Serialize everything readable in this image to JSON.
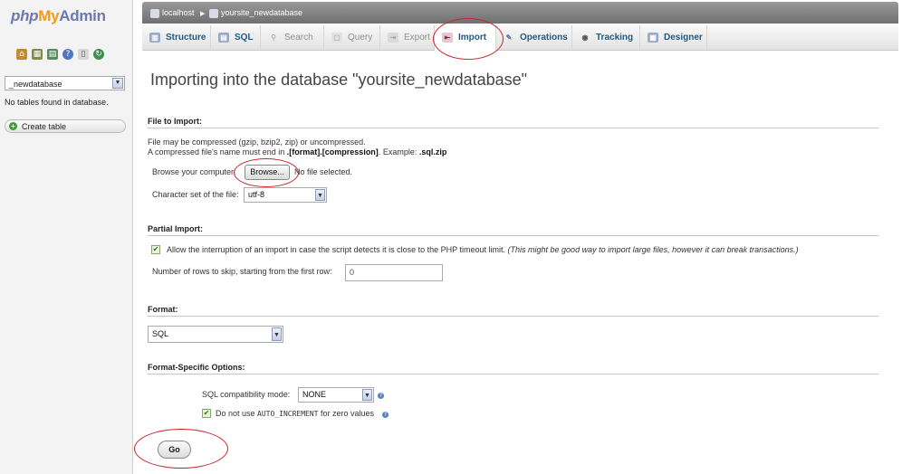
{
  "sidebar": {
    "logo": {
      "php": "php",
      "my": "My",
      "admin": "Admin"
    },
    "quick_icons": [
      "home-icon",
      "table-icon",
      "sql-icon",
      "help-icon",
      "docs-icon",
      "reload-icon"
    ],
    "database_select": "_newdatabase",
    "no_tables_text": "No tables found in database.",
    "create_table_label": "Create table"
  },
  "breadcrumb": {
    "server": "localhost",
    "database": "yoursite_newdatabase"
  },
  "tabs": [
    {
      "label": "Structure",
      "icon": "structure-icon",
      "state": "normal"
    },
    {
      "label": "SQL",
      "icon": "sql-icon",
      "state": "normal"
    },
    {
      "label": "Search",
      "icon": "search-icon",
      "state": "disabled"
    },
    {
      "label": "Query",
      "icon": "query-icon",
      "state": "disabled"
    },
    {
      "label": "Export",
      "icon": "export-icon",
      "state": "disabled"
    },
    {
      "label": "Import",
      "icon": "import-icon",
      "state": "active"
    },
    {
      "label": "Operations",
      "icon": "operations-icon",
      "state": "normal"
    },
    {
      "label": "Tracking",
      "icon": "tracking-icon",
      "state": "normal"
    },
    {
      "label": "Designer",
      "icon": "designer-icon",
      "state": "normal"
    }
  ],
  "page_title": "Importing into the database \"yoursite_newdatabase\"",
  "file_to_import": {
    "title": "File to Import:",
    "compress_note": "File may be compressed (gzip, bzip2, zip) or uncompressed.",
    "name_note_prefix": "A compressed file's name must end in ",
    "name_note_format": ".[format].[compression]",
    "name_note_example_label": ". Example: ",
    "name_note_example": ".sql.zip",
    "browse_label": "Browse your computer:",
    "browse_button": "Browse...",
    "no_file_text": "No file selected.",
    "charset_label": "Character set of the file:",
    "charset_value": "utf-8"
  },
  "partial_import": {
    "title": "Partial Import:",
    "allow_interrupt_checked": true,
    "allow_interrupt_text": "Allow the interruption of an import in case the script detects it is close to the PHP timeout limit.",
    "allow_interrupt_note": "(This might be good way to import large files, however it can break transactions.)",
    "skip_rows_label": "Number of rows to skip, starting from the first row:",
    "skip_rows_value": "0"
  },
  "format": {
    "title": "Format:",
    "value": "SQL"
  },
  "format_options": {
    "title": "Format-Specific Options:",
    "compat_label": "SQL compatibility mode:",
    "compat_value": "NONE",
    "auto_inc_checked": true,
    "auto_inc_prefix": "Do not use",
    "auto_inc_code": "AUTO_INCREMENT",
    "auto_inc_suffix": "for zero values"
  },
  "go_button": "Go",
  "colors": {
    "tab_link": "#235a81",
    "highlight_circle": "#c8262d",
    "topbar": "#7f7f7f"
  }
}
